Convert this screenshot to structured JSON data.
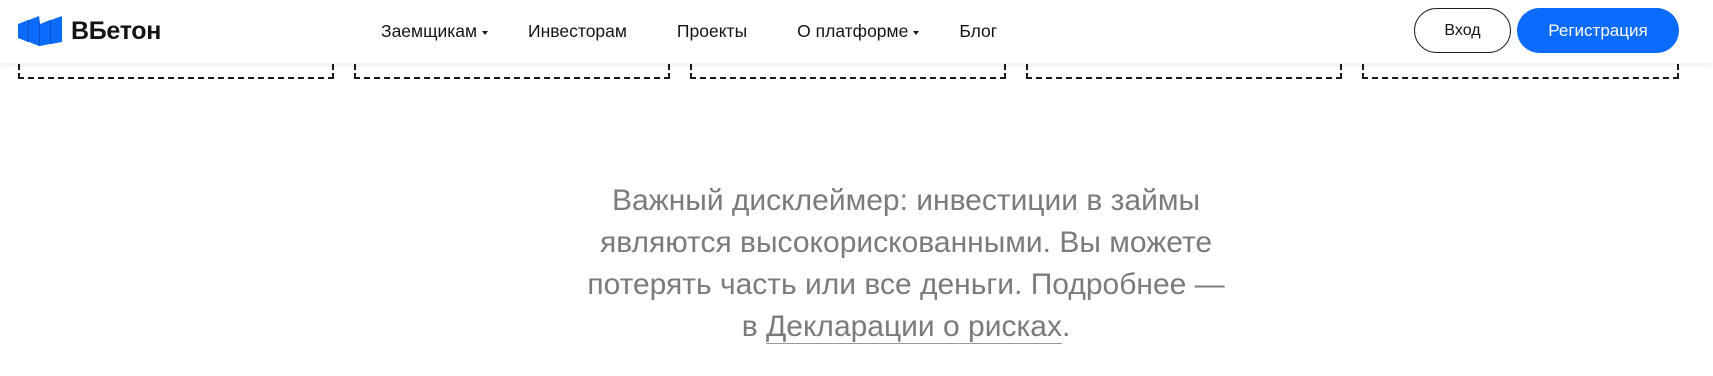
{
  "brand": {
    "name": "ВБетон",
    "accent_color": "#0b6bff"
  },
  "nav": {
    "items": [
      {
        "label": "Заемщикам",
        "has_dropdown": true
      },
      {
        "label": "Инвесторам",
        "has_dropdown": false
      },
      {
        "label": "Проекты",
        "has_dropdown": false
      },
      {
        "label": "О платформе",
        "has_dropdown": true
      },
      {
        "label": "Блог",
        "has_dropdown": false
      }
    ]
  },
  "auth": {
    "login_label": "Вход",
    "register_label": "Регистрация"
  },
  "disclaimer": {
    "line1": "Важный дисклеймер: инвестиции в займы",
    "line2": "являются высокорискованными. Вы можете",
    "line3": "потерять часть или все деньги. Подробнее —",
    "line4_prefix": "в ",
    "link_text": "Декларации о рисках",
    "line4_suffix": "."
  }
}
